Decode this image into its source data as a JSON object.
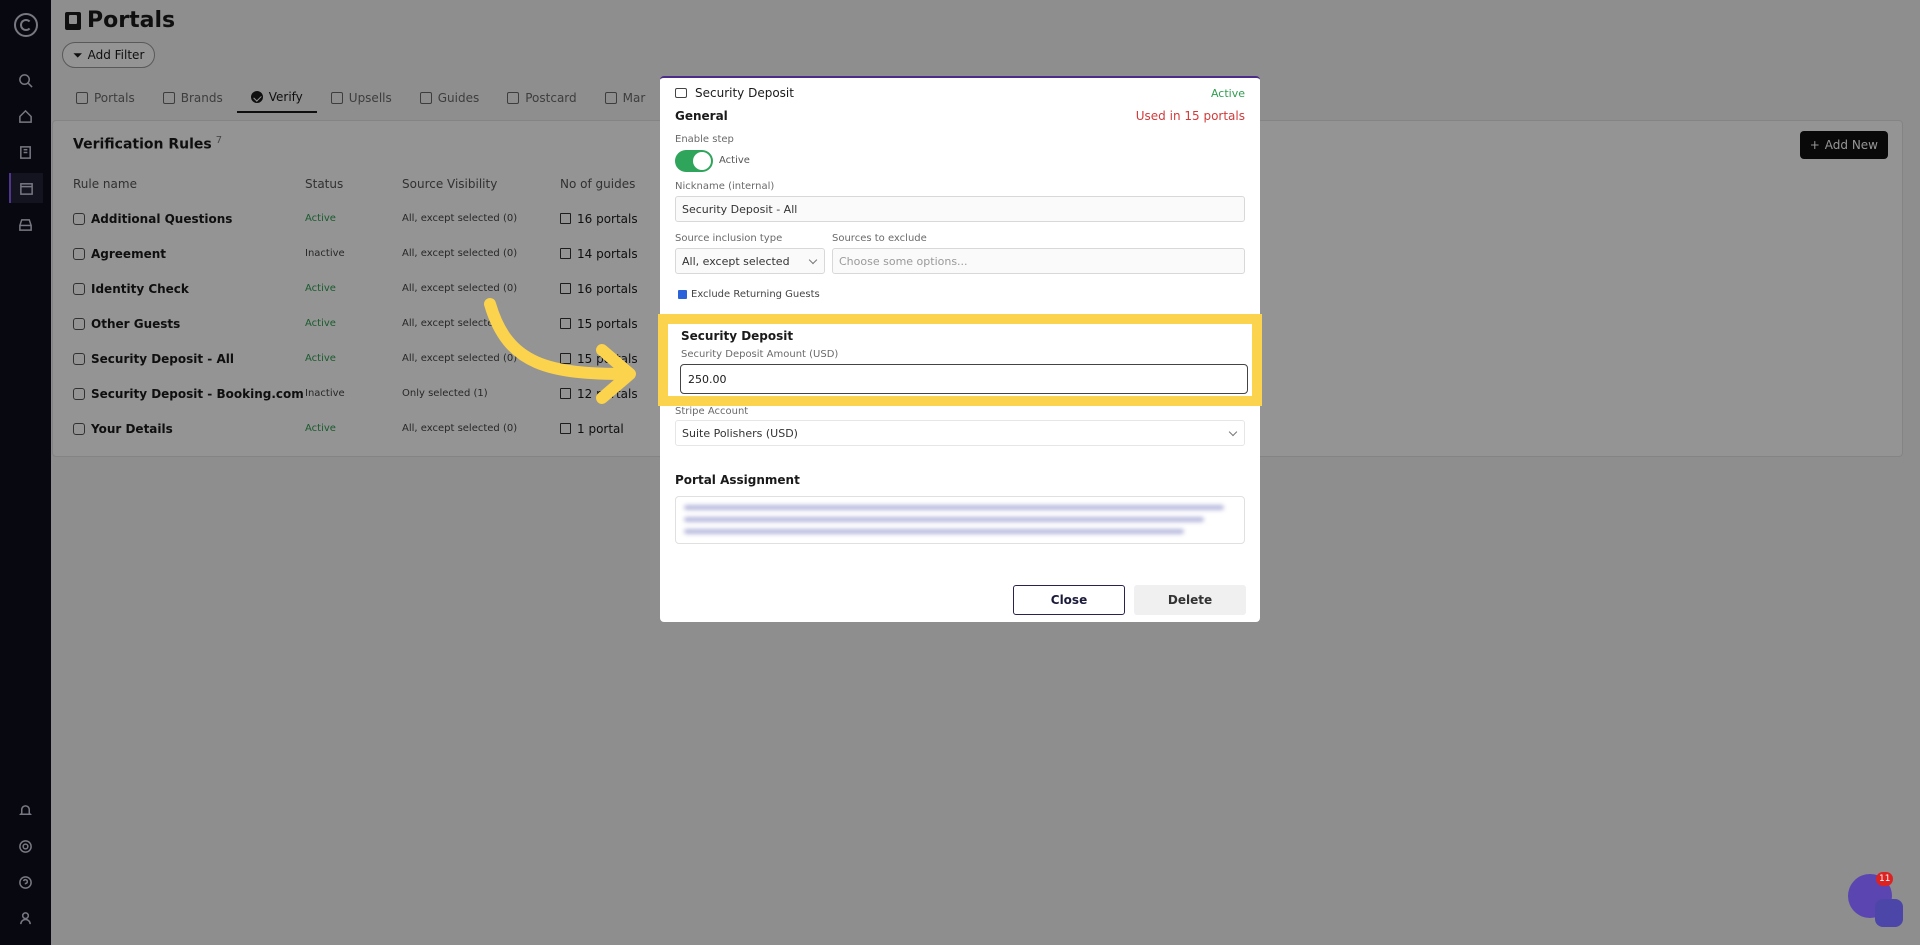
{
  "page": {
    "title": "Portals",
    "filter_label": "Add Filter"
  },
  "tabs": [
    {
      "label": "Portals",
      "icon": "portal-icon"
    },
    {
      "label": "Brands",
      "icon": "image-icon"
    },
    {
      "label": "Verify",
      "icon": "check-circle-icon"
    },
    {
      "label": "Upsells",
      "icon": "dollar-icon"
    },
    {
      "label": "Guides",
      "icon": "map-icon"
    },
    {
      "label": "Postcard",
      "icon": "mail-icon"
    },
    {
      "label": "Mar",
      "icon": "tools-icon"
    }
  ],
  "card": {
    "title": "Verification Rules",
    "count": "7",
    "add_new": "Add New",
    "columns": [
      "Rule name",
      "Status",
      "Source Visibility",
      "No of guides"
    ],
    "rows": [
      {
        "name": "Additional Questions",
        "status": "Active",
        "visibility": "All, except selected (0)",
        "guides": "16 portals"
      },
      {
        "name": "Agreement",
        "status": "Inactive",
        "visibility": "All, except selected (0)",
        "guides": "14 portals"
      },
      {
        "name": "Identity Check",
        "status": "Active",
        "visibility": "All, except selected (0)",
        "guides": "16 portals"
      },
      {
        "name": "Other Guests",
        "status": "Active",
        "visibility": "All, except selected",
        "guides": "15 portals"
      },
      {
        "name": "Security Deposit - All",
        "status": "Active",
        "visibility": "All, except selected (0)",
        "guides": "15 portals"
      },
      {
        "name": "Security Deposit - Booking.com",
        "status": "Inactive",
        "visibility": "Only selected (1)",
        "guides": "12 portals"
      },
      {
        "name": "Your Details",
        "status": "Active",
        "visibility": "All, except selected (0)",
        "guides": "1 portal"
      }
    ]
  },
  "modal": {
    "title": "Security Deposit",
    "status": "Active",
    "general": "General",
    "used_in": "Used in 15 portals",
    "enable_step_label": "Enable step",
    "toggle_label": "Active",
    "nickname_label": "Nickname (internal)",
    "nickname_value": "Security Deposit - All",
    "inclusion_label": "Source inclusion type",
    "inclusion_value": "All, except selected",
    "exclude_label": "Sources to exclude",
    "exclude_placeholder": "Choose some options...",
    "exclude_returning": "Exclude Returning Guests",
    "deposit_section": "Security Deposit",
    "deposit_amount_label": "Security Deposit Amount (USD)",
    "deposit_amount_value": "250.00",
    "account_label": "Stripe Account",
    "account_value": "Suite Polishers (USD)",
    "portal_assignment": "Portal Assignment",
    "close": "Close",
    "delete": "Delete"
  },
  "chat": {
    "badge": "11"
  },
  "colors": {
    "accent": "#fcd34d",
    "active": "#2e9e4f",
    "danger": "#d23a3a",
    "sidebar": "#0f0f1e"
  }
}
